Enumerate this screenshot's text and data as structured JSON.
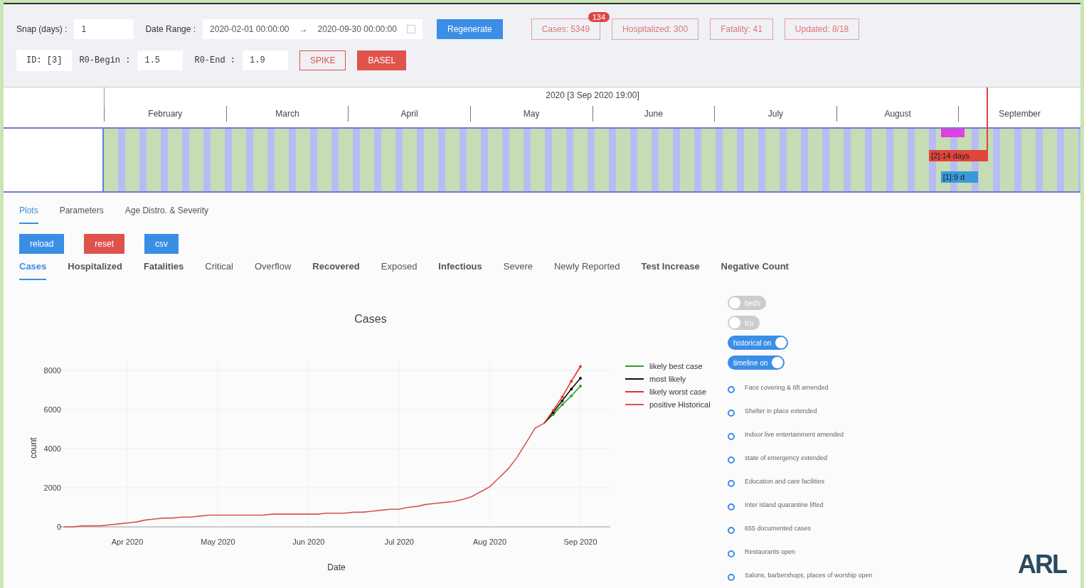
{
  "controls": {
    "snap": {
      "label": "Snap (days) :",
      "value": "1"
    },
    "date_range": {
      "label": "Date Range :",
      "start": "2020-02-01 00:00:00",
      "separator": "→",
      "end": "2020-09-30 00:00:00"
    },
    "regenerate": "Regenerate",
    "id": "ID: [3]",
    "r0_begin": {
      "label": "R0-Begin :",
      "value": "1.5"
    },
    "r0_end": {
      "label": "R0-End :",
      "value": "1.9"
    },
    "mode_buttons": [
      {
        "label": "SPIKE",
        "selected": false
      },
      {
        "label": "BASEL",
        "selected": true
      }
    ]
  },
  "stats": [
    {
      "label": "Cases: 5349",
      "badge": "134"
    },
    {
      "label": "Hospitalized: 300"
    },
    {
      "label": "Fatality: 41"
    },
    {
      "label": "Updated: 8/18"
    }
  ],
  "timeline": {
    "title": "2020 [3 Sep 2020 19:00]",
    "months": [
      "February",
      "March",
      "April",
      "May",
      "June",
      "July",
      "August",
      "September"
    ],
    "bars": [
      {
        "color": "#e040e0"
      },
      {
        "label": "[2]:14 days",
        "color": "#e0453c"
      },
      {
        "label": "[1]:9 d",
        "color": "#3a9ad9"
      }
    ]
  },
  "tabs": [
    {
      "label": "Plots",
      "selected": true
    },
    {
      "label": "Parameters",
      "selected": false
    },
    {
      "label": "Age Distro. & Severity",
      "selected": false
    }
  ],
  "actions": [
    {
      "label": "reload",
      "color": "#3a8ee6"
    },
    {
      "label": "reset",
      "color": "#e0524c"
    },
    {
      "label": "csv",
      "color": "#3a8ee6"
    }
  ],
  "plot_tabs": [
    {
      "label": "Cases",
      "selected": true,
      "bold": true
    },
    {
      "label": "Hospitalized",
      "selected": false,
      "bold": true
    },
    {
      "label": "Fatalities",
      "selected": false,
      "bold": true
    },
    {
      "label": "Critical",
      "selected": false,
      "bold": false
    },
    {
      "label": "Overflow",
      "selected": false,
      "bold": false
    },
    {
      "label": "Recovered",
      "selected": false,
      "bold": true
    },
    {
      "label": "Exposed",
      "selected": false,
      "bold": false
    },
    {
      "label": "Infectious",
      "selected": false,
      "bold": true
    },
    {
      "label": "Severe",
      "selected": false,
      "bold": false
    },
    {
      "label": "Newly Reported",
      "selected": false,
      "bold": false
    },
    {
      "label": "Test Increase",
      "selected": false,
      "bold": true
    },
    {
      "label": "Negative Count",
      "selected": false,
      "bold": true
    }
  ],
  "chart_data": {
    "type": "line",
    "title": "Cases",
    "xlabel": "Date",
    "ylabel": "count",
    "categories": [
      null,
      null,
      null,
      null,
      null,
      null,
      null,
      null,
      null,
      null,
      "Apr 2020",
      null,
      null,
      null,
      null,
      null,
      null,
      null,
      null,
      null,
      "May 2020",
      null,
      null,
      null,
      null,
      null,
      null,
      null,
      null,
      null,
      "Jun 2020",
      null,
      null,
      null,
      null,
      null,
      null,
      null,
      null,
      null,
      "Jul 2020",
      null,
      null,
      null,
      null,
      null,
      null,
      null,
      null,
      null,
      "Aug 2020",
      null,
      null,
      null,
      null,
      null,
      null,
      null,
      null,
      null,
      "Sep 2020"
    ],
    "series": [
      {
        "name": "likely best case",
        "color": "#2ca02c",
        "values": [
          null,
          null,
          null,
          null,
          null,
          null,
          null,
          null,
          null,
          null,
          null,
          null,
          null,
          null,
          null,
          null,
          null,
          null,
          null,
          null,
          null,
          null,
          null,
          null,
          null,
          null,
          null,
          null,
          null,
          null,
          null,
          null,
          null,
          null,
          null,
          null,
          null,
          null,
          null,
          null,
          null,
          null,
          null,
          null,
          null,
          null,
          null,
          null,
          null,
          null,
          null,
          null,
          null,
          null,
          null,
          null,
          5300,
          5750,
          6250,
          6700,
          7200
        ]
      },
      {
        "name": "most likely",
        "color": "#111111",
        "values": [
          null,
          null,
          null,
          null,
          null,
          null,
          null,
          null,
          null,
          null,
          null,
          null,
          null,
          null,
          null,
          null,
          null,
          null,
          null,
          null,
          null,
          null,
          null,
          null,
          null,
          null,
          null,
          null,
          null,
          null,
          null,
          null,
          null,
          null,
          null,
          null,
          null,
          null,
          null,
          null,
          null,
          null,
          null,
          null,
          null,
          null,
          null,
          null,
          null,
          null,
          null,
          null,
          null,
          null,
          null,
          null,
          5300,
          5850,
          6450,
          7050,
          7600
        ]
      },
      {
        "name": "likely worst case",
        "color": "#e8312a",
        "values": [
          null,
          null,
          null,
          null,
          null,
          null,
          null,
          null,
          null,
          null,
          null,
          null,
          null,
          null,
          null,
          null,
          null,
          null,
          null,
          null,
          null,
          null,
          null,
          null,
          null,
          null,
          null,
          null,
          null,
          null,
          null,
          null,
          null,
          null,
          null,
          null,
          null,
          null,
          null,
          null,
          null,
          null,
          null,
          null,
          null,
          null,
          null,
          null,
          null,
          null,
          null,
          null,
          null,
          null,
          null,
          null,
          5300,
          5950,
          6650,
          7450,
          8200
        ]
      },
      {
        "name": "positive Historical",
        "color": "#d9534f",
        "values": [
          null,
          null,
          null,
          0,
          0,
          50,
          50,
          50,
          100,
          150,
          200,
          250,
          350,
          400,
          450,
          450,
          500,
          500,
          550,
          600,
          600,
          600,
          600,
          600,
          600,
          600,
          650,
          650,
          650,
          650,
          650,
          650,
          700,
          700,
          700,
          750,
          750,
          800,
          850,
          900,
          900,
          1000,
          1050,
          1150,
          1200,
          1250,
          1300,
          1400,
          1550,
          1800,
          2050,
          2500,
          2950,
          3550,
          4300,
          5050,
          5300,
          null,
          null,
          null,
          null
        ]
      }
    ],
    "grid": true,
    "legend": true,
    "yticks": [
      0,
      2000,
      4000,
      6000,
      8000
    ],
    "ylim": [
      0,
      8400
    ]
  },
  "toggles": [
    {
      "label": "beds",
      "on": false
    },
    {
      "label": "icu",
      "on": false
    },
    {
      "label": "historical on",
      "on": true
    },
    {
      "label": "timeline on",
      "on": true
    }
  ],
  "events": [
    "Face covering & 6ft amended",
    "Shelter in place extended",
    "Indoor live entertainment amended",
    "state of emergency extended",
    "Education and care facilities",
    "Inter island quarantine lifted",
    "655 documented cases",
    "Restaurants open",
    "Salons, barbershops, places of worship open"
  ],
  "logo": "ARL"
}
